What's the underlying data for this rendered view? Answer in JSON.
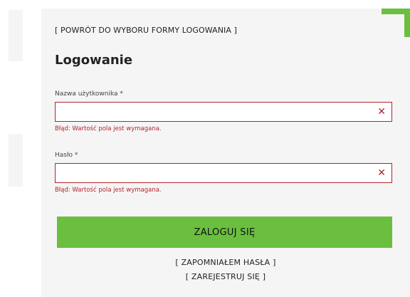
{
  "back_link": "[ POWRÓT DO WYBORU FORMY LOGOWANIA ]",
  "title": "Logowanie",
  "username": {
    "label": "Nazwa użytkownika *",
    "value": "",
    "error": "Błąd: Wartość pola jest wymagana.",
    "clear_icon": "✕"
  },
  "password": {
    "label": "Hasło *",
    "value": "",
    "error": "Błąd: Wartość pola jest wymagana.",
    "clear_icon": "✕"
  },
  "login_button": "ZALOGUJ SIĘ",
  "forgot_password": "[ ZAPOMNIAŁEM HASŁA ]",
  "register": "[ ZAREJESTRUJ SIĘ ]",
  "colors": {
    "accent_green": "#6bbf3f",
    "error_red": "#b3232e",
    "panel_bg": "#f5f5f5"
  }
}
